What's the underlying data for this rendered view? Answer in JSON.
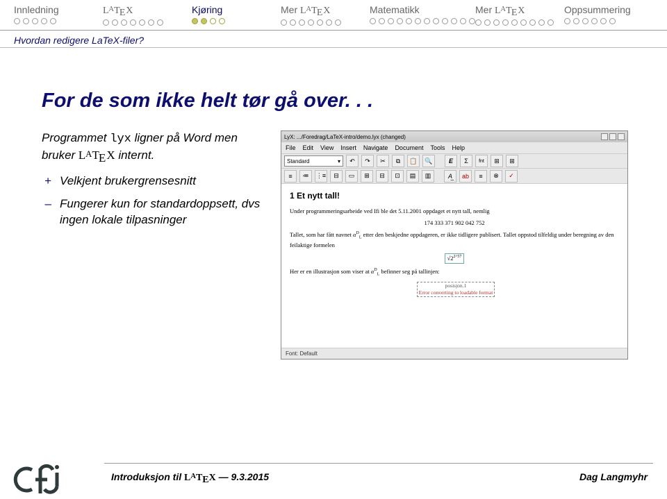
{
  "nav": {
    "tabs": [
      {
        "label": "Innledning",
        "dots": 5,
        "filled": 0,
        "active": false
      },
      {
        "label": "LATEX",
        "dots": 7,
        "filled": 0,
        "active": false,
        "latex": true
      },
      {
        "label": "Kjøring",
        "dots": 4,
        "filled": 2,
        "active": true,
        "accent": true
      },
      {
        "label": "Mer LATEX",
        "dots": 7,
        "filled": 0,
        "active": false,
        "latex": true
      },
      {
        "label": "Matematikk",
        "dots": 12,
        "filled": 0,
        "active": false
      },
      {
        "label": "Mer LATEX",
        "dots": 9,
        "filled": 0,
        "active": false,
        "latex": true
      },
      {
        "label": "Oppsummering",
        "dots": 6,
        "filled": 0,
        "active": false
      }
    ]
  },
  "subsection": "Hvordan redigere LaTeX-filer?",
  "title": "For de som ikke helt tør gå over. . .",
  "left": {
    "para_pre": "Programmet ",
    "para_tt": "lyx",
    "para_mid": " ligner på Word men bruker ",
    "para_post": " internt.",
    "bullets": [
      {
        "mark": "+",
        "text": "Velkjent brukergrensesnitt"
      },
      {
        "mark": "–",
        "text": "Fungerer kun for standardoppsett, dvs ingen lokale tilpasninger"
      }
    ]
  },
  "lyx": {
    "title": "LyX: .../Foredrag/LaTeX-intro/demo.lyx (changed)",
    "menu": [
      "File",
      "Edit",
      "View",
      "Insert",
      "Navigate",
      "Document",
      "Tools",
      "Help"
    ],
    "paragraph_style": "Standard",
    "tool2_glyphs": [
      "≡",
      "≔",
      "⋮≡",
      "⊟",
      "▭",
      "⊞",
      "⊟",
      "⊡",
      "▤",
      "▥",
      "|",
      "A͟",
      "ab",
      "≡",
      "⊗",
      "✓"
    ],
    "tool1_glyphs": [
      "↶",
      "↷",
      "✂",
      "⧉",
      "📋",
      "🔍",
      "|",
      "E",
      "Σ",
      "fnt",
      "⊞",
      "⊞"
    ],
    "doc": {
      "heading": "1   Et nytt tall!",
      "p1_a": "Under programmeringsarbeide ved Ifi ble det 5.11.2001 oppdaget et nytt tall, nemlig",
      "p1_num": "174 333 371 902 042 752",
      "p2_a": "Tallet, som har fått navnet ",
      "p2_b": " etter den beskjedne oppdageren, er ikke tidligere publisert. Tallet oppstod tilfeldig under beregning av den feilaktige formelen",
      "formula": "√2",
      "formula_exp": "2^57",
      "p3_a": "Her er en illustrasjon som viser at ",
      "p3_b": " befinner seg på tallinjen:",
      "label": "posisjon.1",
      "label_note": "Error converting to loadable format"
    },
    "status": "Font: Default"
  },
  "footer": {
    "text_pre": "Introduksjon til ",
    "text_post": " — 9.3.2015",
    "author": "Dag Langmyhr"
  }
}
